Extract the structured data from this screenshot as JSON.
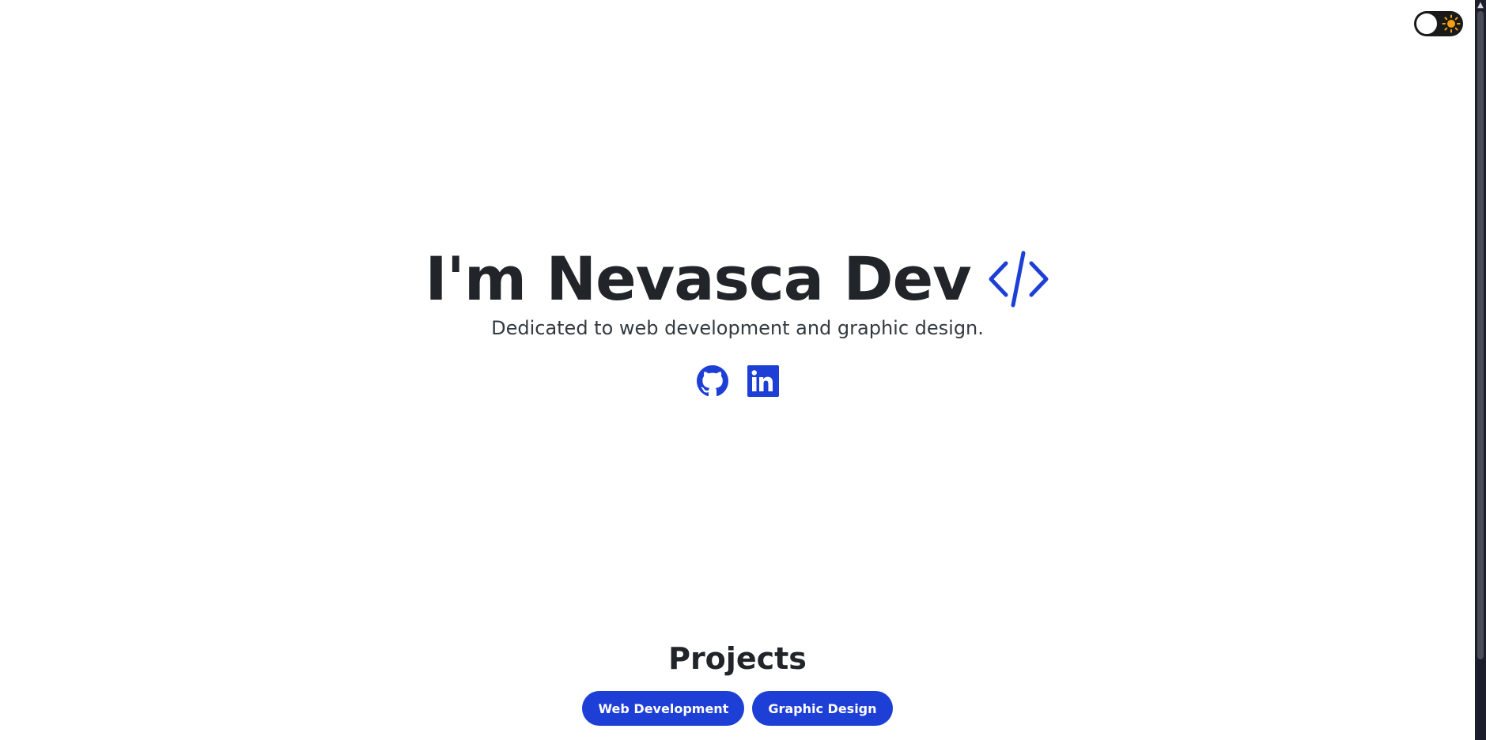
{
  "hero": {
    "title": "I'm Nevasca Dev",
    "subtitle": "Dedicated to web development and graphic design."
  },
  "social": {
    "github_icon": "github-icon",
    "linkedin_icon": "linkedin-icon"
  },
  "projects": {
    "heading": "Projects",
    "filters": [
      {
        "label": "Web Development"
      },
      {
        "label": "Graphic Design"
      }
    ]
  },
  "theme_toggle": {
    "state": "light",
    "icon": "sun-icon"
  },
  "colors": {
    "accent": "#1d3fd6",
    "text": "#212529",
    "toggle_bg": "#1a1a1a",
    "sun": "#f5a00f"
  }
}
